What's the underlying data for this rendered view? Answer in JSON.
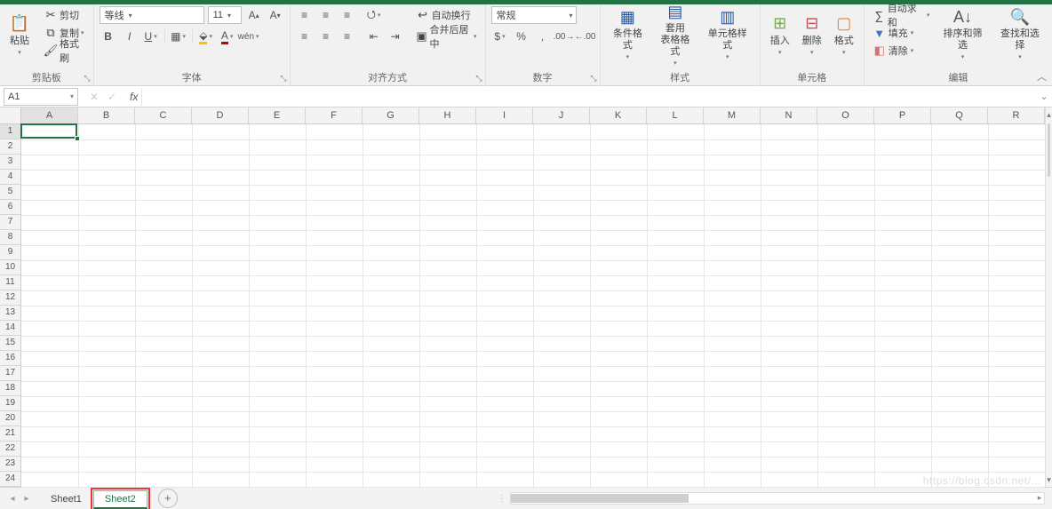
{
  "ribbon": {
    "clipboard": {
      "paste": "粘贴",
      "cut": "剪切",
      "copy": "复制",
      "formatpainter": "格式刷",
      "label": "剪贴板"
    },
    "font": {
      "name": "等线",
      "size": "11",
      "label": "字体",
      "wen": "wén"
    },
    "alignment": {
      "wrap": "自动换行",
      "merge": "合并后居中",
      "label": "对齐方式"
    },
    "number": {
      "format": "常规",
      "label": "数字"
    },
    "styles": {
      "cond": "条件格式",
      "table": "套用\n表格格式",
      "cellstyle": "单元格样式",
      "label": "样式"
    },
    "cells": {
      "insert": "插入",
      "delete": "删除",
      "format": "格式",
      "label": "单元格"
    },
    "editing": {
      "sum": "自动求和",
      "fill": "填充",
      "clear": "清除",
      "sort": "排序和筛选",
      "find": "查找和选择",
      "label": "编辑"
    }
  },
  "namebox": "A1",
  "columns": [
    "A",
    "B",
    "C",
    "D",
    "E",
    "F",
    "G",
    "H",
    "I",
    "J",
    "K",
    "L",
    "M",
    "N",
    "O",
    "P",
    "Q",
    "R"
  ],
  "rows": [
    "1",
    "2",
    "3",
    "4",
    "5",
    "6",
    "7",
    "8",
    "9",
    "10",
    "11",
    "12",
    "13",
    "14",
    "15",
    "16",
    "17",
    "18",
    "19",
    "20",
    "21",
    "22",
    "23",
    "24"
  ],
  "tabs": {
    "sheet1": "Sheet1",
    "sheet2": "Sheet2"
  },
  "watermark": "https://blog.csdn.net/..."
}
